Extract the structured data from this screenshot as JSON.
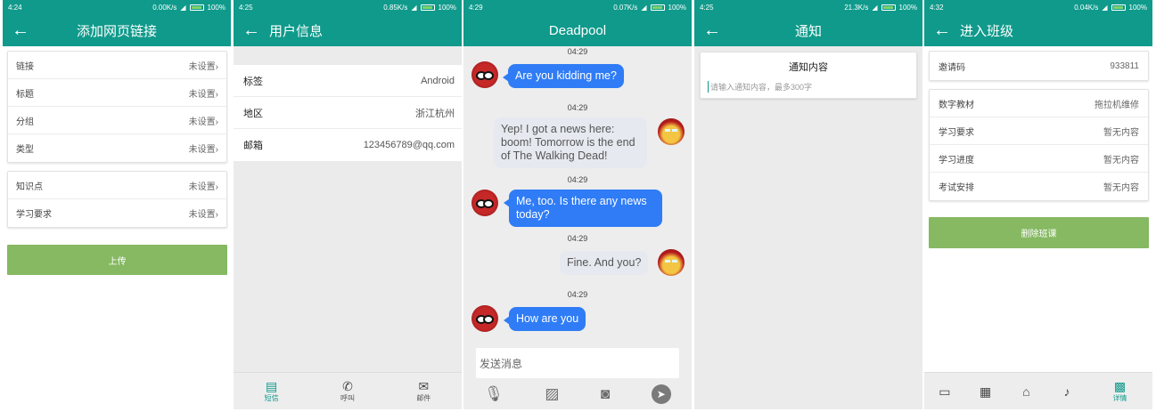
{
  "colors": {
    "primary": "#0f9a8b",
    "upload_button": "#86b962",
    "delete_button": "#86b962",
    "bubble_blue": "#2f7cf6",
    "bubble_grey": "#e6e9ef"
  },
  "screen1": {
    "status": {
      "time": "4:24",
      "speed": "0.00K/s",
      "battery": "100%"
    },
    "title": "添加网页链接",
    "group1": [
      {
        "label": "链接",
        "value": "未设置"
      },
      {
        "label": "标题",
        "value": "未设置"
      },
      {
        "label": "分组",
        "value": "未设置"
      },
      {
        "label": "类型",
        "value": "未设置"
      }
    ],
    "group2": [
      {
        "label": "知识点",
        "value": "未设置"
      },
      {
        "label": "学习要求",
        "value": "未设置"
      }
    ],
    "upload_label": "上传"
  },
  "screen2": {
    "status": {
      "time": "4:25",
      "speed": "0.85K/s",
      "battery": "100%"
    },
    "title": "用户信息",
    "rows": [
      {
        "label": "标签",
        "value": "Android"
      },
      {
        "label": "地区",
        "value": "浙江杭州"
      },
      {
        "label": "邮箱",
        "value": "123456789@qq.com"
      }
    ],
    "nav": [
      {
        "icon": "message-icon",
        "label": "短信"
      },
      {
        "icon": "phone-icon",
        "label": "呼叫"
      },
      {
        "icon": "mail-icon",
        "label": "邮件"
      }
    ]
  },
  "screen3": {
    "status": {
      "time": "4:29",
      "speed": "0.07K/s",
      "battery": "100%"
    },
    "title": "Deadpool",
    "timestamps": [
      "04:29",
      "04:29",
      "04:29",
      "04:29",
      "04:29"
    ],
    "messages": [
      {
        "side": "left",
        "text": "Are you kidding me?"
      },
      {
        "side": "right",
        "text": "Yep! I got a news here: boom! Tomorrow is the end of The Walking Dead!"
      },
      {
        "side": "left",
        "text": "Me, too. Is there any news today?"
      },
      {
        "side": "right",
        "text": "Fine. And you?"
      },
      {
        "side": "left",
        "text": "How are you"
      }
    ],
    "input_placeholder": "发送消息"
  },
  "screen4": {
    "status": {
      "time": "4:25",
      "speed": "21.3K/s",
      "battery": "100%"
    },
    "title": "通知",
    "card_title": "通知内容",
    "input_placeholder": "请输入通知内容，最多300字"
  },
  "screen5": {
    "status": {
      "time": "4:32",
      "speed": "0.04K/s",
      "battery": "100%"
    },
    "title": "进入班级",
    "invite": {
      "label": "邀请码",
      "value": "933811"
    },
    "rows": [
      {
        "label": "数字教材",
        "value": "拖拉机维修"
      },
      {
        "label": "学习要求",
        "value": "暂无内容"
      },
      {
        "label": "学习进度",
        "value": "暂无内容"
      },
      {
        "label": "考试安排",
        "value": "暂无内容"
      }
    ],
    "delete_label": "删除班课",
    "nav": [
      {
        "icon": "folder-icon",
        "label": ""
      },
      {
        "icon": "library-icon",
        "label": ""
      },
      {
        "icon": "home-icon",
        "label": ""
      },
      {
        "icon": "bell-icon",
        "label": ""
      },
      {
        "icon": "grid-icon",
        "label": "详情"
      }
    ]
  }
}
